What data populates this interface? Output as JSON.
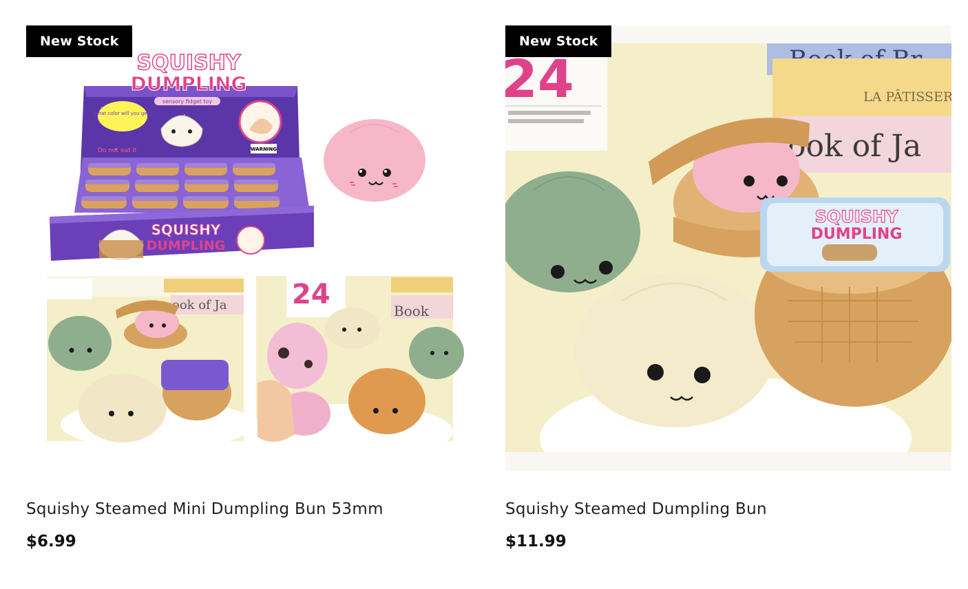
{
  "products": [
    {
      "badge": "New Stock",
      "title": "Squishy Steamed Mini Dumpling Bun 53mm",
      "price": "$6.99",
      "image": {
        "box_logo_line1": "SQUISHY",
        "box_logo_line2": "DUMPLING",
        "box_tagline": "sensory fidget toy",
        "box_bubble": "What color will you get?",
        "box_warning_text": "Do not eat it",
        "box_warning_label": "WARNING"
      }
    },
    {
      "badge": "New Stock",
      "title": "Squishy Steamed Dumpling Bun",
      "price": "$11.99",
      "image": {
        "book_text_1": "Book of Br",
        "book_text_2": "LA PÂTISSER",
        "book_text_3": "ook of Ja",
        "calendar_num": "24",
        "sleeve_logo_line1": "SQUISHY",
        "sleeve_logo_line2": "DUMPLING"
      }
    }
  ],
  "colors": {
    "badge_bg": "#000000",
    "badge_text": "#ffffff",
    "box_purple": "#6a3fb8",
    "logo_pink": "#e0428a",
    "bun_pink": "#f6b8c8",
    "bun_green": "#8fae8e",
    "bun_cream": "#f1e6c6",
    "bun_orange": "#e09a50",
    "steamer_tan": "#d7a25f",
    "bg_yellow": "#f4efc8"
  }
}
